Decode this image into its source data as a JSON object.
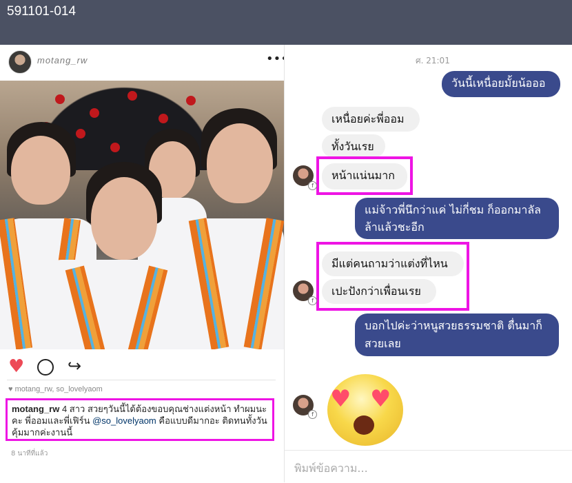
{
  "window": {
    "title": "591101-014"
  },
  "instagram": {
    "username_header": "motang_rw",
    "more_label": "•••",
    "likes_text": "♥ motang_rw, so_lovelyaom",
    "caption": {
      "user": "motang_rw",
      "text_part1": " 4 สาว สวยๆวันนี้ได้ต้องขอบคุณช่างแต่งหน้า ทำผมนะคะ พี่ออมและพี่เฟิร์น ",
      "mention": "@so_lovelyaom",
      "text_part2": " คือแบบดีมากอะ ติดทนทั้งวัน คุ้มมากค่ะงานนี้"
    },
    "time_ago": "8 นาทีที่แล้ว"
  },
  "messenger": {
    "timestamp": "ศ. 21:01",
    "messages": [
      {
        "dir": "out",
        "text": "วันนี้เหนื่อยมั้ยน้อออ"
      },
      {
        "dir": "in",
        "text": "เหนื่อยค่ะพี่ออม"
      },
      {
        "dir": "in",
        "text": "ทั้งวันเรย"
      },
      {
        "dir": "in",
        "text": "หน้าแน่นมาก"
      },
      {
        "dir": "out",
        "text": "แม่จ้าวพี่นึกว่าแค่ ไม่กี่ชม ก็ออกมาลัล ล้าแล้วชะอีก"
      },
      {
        "dir": "in",
        "text": "มีแต่คนถามว่าแต่งที่ไหน"
      },
      {
        "dir": "in",
        "text": "เปะปังกว่าเพื่อนเรย"
      },
      {
        "dir": "out",
        "text": "บอกไปค่ะว่าหนูสวยธรรมชาติ ตื่นมาก็ สวยเลย"
      }
    ],
    "input_placeholder": "พิมพ์ข้อความ..."
  },
  "colors": {
    "highlight": "#ee14e4",
    "outgoing_bubble": "#3a4a8c",
    "topbar": "#4b5163"
  }
}
